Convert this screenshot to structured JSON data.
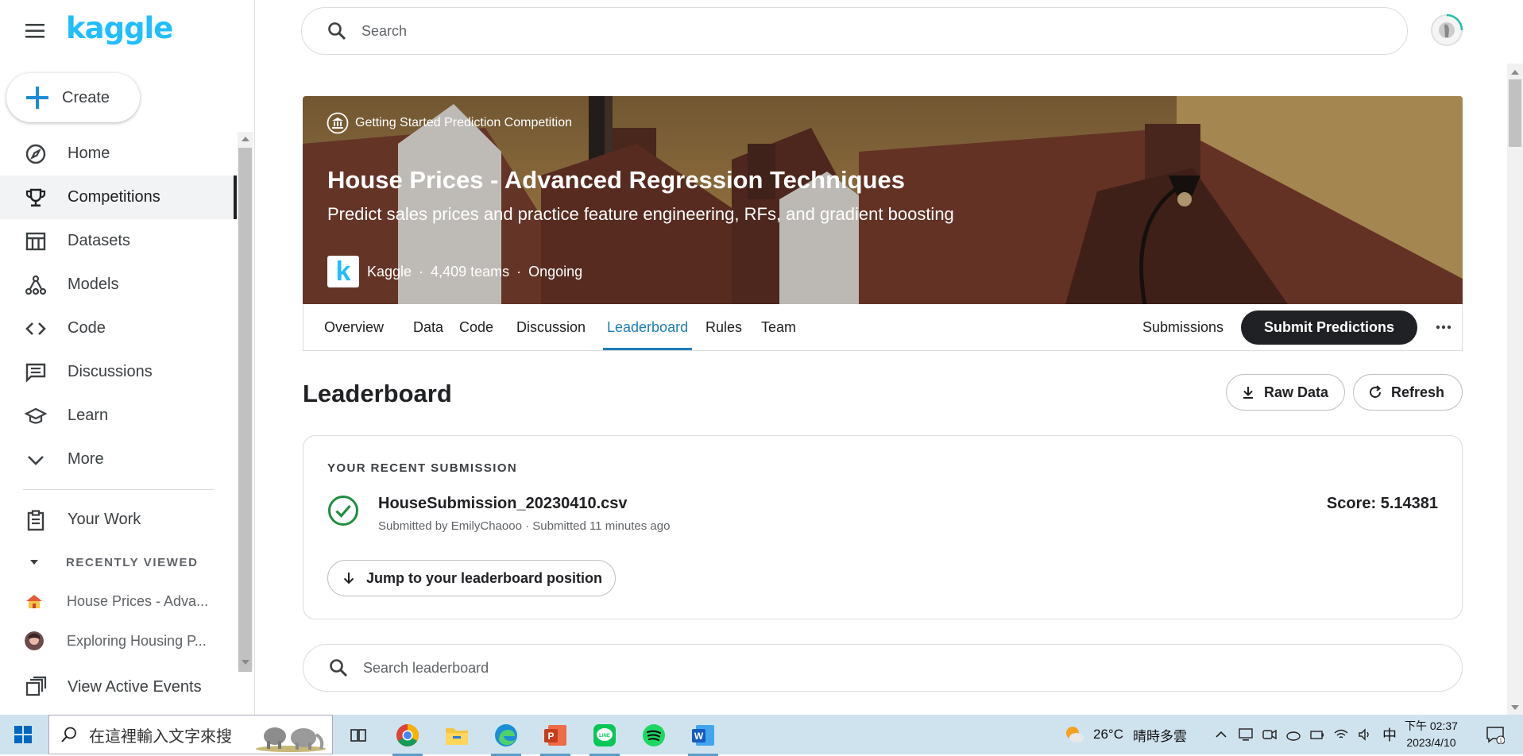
{
  "brand": {
    "logo_text": "kaggle",
    "accent": "#20beff"
  },
  "create": {
    "label": "Create"
  },
  "nav": {
    "items": [
      {
        "label": "Home",
        "icon": "compass-icon"
      },
      {
        "label": "Competitions",
        "icon": "trophy-icon",
        "active": true
      },
      {
        "label": "Datasets",
        "icon": "table-icon"
      },
      {
        "label": "Models",
        "icon": "models-icon"
      },
      {
        "label": "Code",
        "icon": "code-icon"
      },
      {
        "label": "Discussions",
        "icon": "discussion-icon"
      },
      {
        "label": "Learn",
        "icon": "school-icon"
      },
      {
        "label": "More",
        "icon": "chevron-down-icon"
      }
    ],
    "your_work": "Your Work",
    "recently_viewed_heading": "RECENTLY VIEWED",
    "recently_viewed": [
      "House Prices - Adva...",
      "Exploring Housing P..."
    ],
    "view_active_events": "View Active Events"
  },
  "search": {
    "placeholder": "Search"
  },
  "competition": {
    "tag": "Getting Started Prediction Competition",
    "title": "House Prices - Advanced Regression Techniques",
    "subtitle": "Predict sales prices and practice feature engineering, RFs, and gradient boosting",
    "host_logo": "k",
    "host": "Kaggle",
    "teams": "4,409 teams",
    "status": "Ongoing"
  },
  "tabs": {
    "items": [
      "Overview",
      "Data",
      "Code",
      "Discussion",
      "Leaderboard",
      "Rules",
      "Team"
    ],
    "active": "Leaderboard",
    "submissions": "Submissions",
    "submit": "Submit Predictions"
  },
  "leaderboard": {
    "title": "Leaderboard",
    "raw_data": "Raw Data",
    "refresh": "Refresh",
    "recent_heading": "YOUR RECENT SUBMISSION",
    "file": "HouseSubmission_20230410.csv",
    "submitted": "Submitted by EmilyChaooo · Submitted 11 minutes ago",
    "score": "Score: 5.14381",
    "jump": "Jump to your leaderboard position",
    "search_placeholder": "Search leaderboard"
  },
  "taskbar": {
    "search_placeholder": "在這裡輸入文字來搜",
    "weather_temp": "26°C",
    "weather_text": "晴時多雲",
    "ime": "中",
    "time_period": "下午 02:37",
    "date": "2023/4/10",
    "notif_count": "1"
  }
}
